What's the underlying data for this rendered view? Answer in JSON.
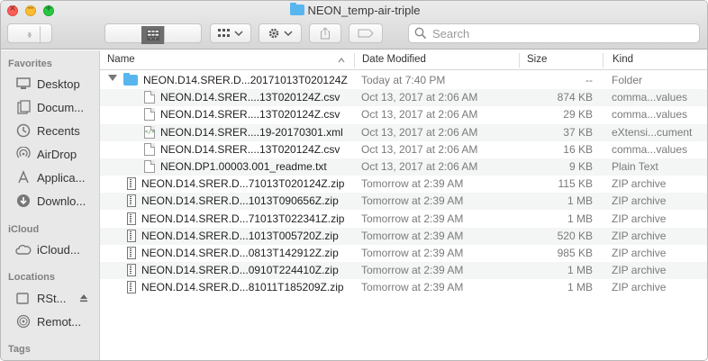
{
  "window": {
    "title": "NEON_temp-air-triple"
  },
  "toolbar": {
    "search_placeholder": "Search",
    "back": "‹",
    "forward": "›"
  },
  "sidebar": {
    "favorites_label": "Favorites",
    "favorites": [
      {
        "label": "Desktop",
        "icon": "desktop-icon"
      },
      {
        "label": "Docum...",
        "icon": "documents-icon"
      },
      {
        "label": "Recents",
        "icon": "recents-icon"
      },
      {
        "label": "AirDrop",
        "icon": "airdrop-icon"
      },
      {
        "label": "Applica...",
        "icon": "applications-icon"
      },
      {
        "label": "Downlo...",
        "icon": "downloads-icon"
      }
    ],
    "icloud_label": "iCloud",
    "icloud": [
      {
        "label": "iCloud...",
        "icon": "cloud-icon"
      }
    ],
    "locations_label": "Locations",
    "locations": [
      {
        "label": "RSt...",
        "icon": "disk-icon"
      },
      {
        "label": "Remot...",
        "icon": "remote-disc-icon"
      }
    ],
    "tags_label": "Tags"
  },
  "columns": {
    "name": "Name",
    "date": "Date Modified",
    "size": "Size",
    "kind": "Kind"
  },
  "rows": [
    {
      "name": "NEON.D14.SRER.D...20171013T020124Z",
      "date": "Today at 7:40 PM",
      "size": "--",
      "kind": "Folder",
      "type": "folder"
    },
    {
      "name": "NEON.D14.SRER....13T020124Z.csv",
      "date": "Oct 13, 2017 at 2:06 AM",
      "size": "874 KB",
      "kind": "comma...values",
      "type": "doc"
    },
    {
      "name": "NEON.D14.SRER....13T020124Z.csv",
      "date": "Oct 13, 2017 at 2:06 AM",
      "size": "29 KB",
      "kind": "comma...values",
      "type": "doc"
    },
    {
      "name": "NEON.D14.SRER....19-20170301.xml",
      "date": "Oct 13, 2017 at 2:06 AM",
      "size": "37 KB",
      "kind": "eXtensi...cument",
      "type": "xml"
    },
    {
      "name": "NEON.D14.SRER....13T020124Z.csv",
      "date": "Oct 13, 2017 at 2:06 AM",
      "size": "16 KB",
      "kind": "comma...values",
      "type": "doc"
    },
    {
      "name": "NEON.DP1.00003.001_readme.txt",
      "date": "Oct 13, 2017 at 2:06 AM",
      "size": "9 KB",
      "kind": "Plain Text",
      "type": "doc"
    },
    {
      "name": "NEON.D14.SRER.D...71013T020124Z.zip",
      "date": "Tomorrow at 2:39 AM",
      "size": "115 KB",
      "kind": "ZIP archive",
      "type": "zip"
    },
    {
      "name": "NEON.D14.SRER.D...1013T090656Z.zip",
      "date": "Tomorrow at 2:39 AM",
      "size": "1 MB",
      "kind": "ZIP archive",
      "type": "zip"
    },
    {
      "name": "NEON.D14.SRER.D...71013T022341Z.zip",
      "date": "Tomorrow at 2:39 AM",
      "size": "1 MB",
      "kind": "ZIP archive",
      "type": "zip"
    },
    {
      "name": "NEON.D14.SRER.D...1013T005720Z.zip",
      "date": "Tomorrow at 2:39 AM",
      "size": "520 KB",
      "kind": "ZIP archive",
      "type": "zip"
    },
    {
      "name": "NEON.D14.SRER.D...0813T142912Z.zip",
      "date": "Tomorrow at 2:39 AM",
      "size": "985 KB",
      "kind": "ZIP archive",
      "type": "zip"
    },
    {
      "name": "NEON.D14.SRER.D...0910T224410Z.zip",
      "date": "Tomorrow at 2:39 AM",
      "size": "1 MB",
      "kind": "ZIP archive",
      "type": "zip"
    },
    {
      "name": "NEON.D14.SRER.D...81011T185209Z.zip",
      "date": "Tomorrow at 2:39 AM",
      "size": "1 MB",
      "kind": "ZIP archive",
      "type": "zip"
    }
  ]
}
